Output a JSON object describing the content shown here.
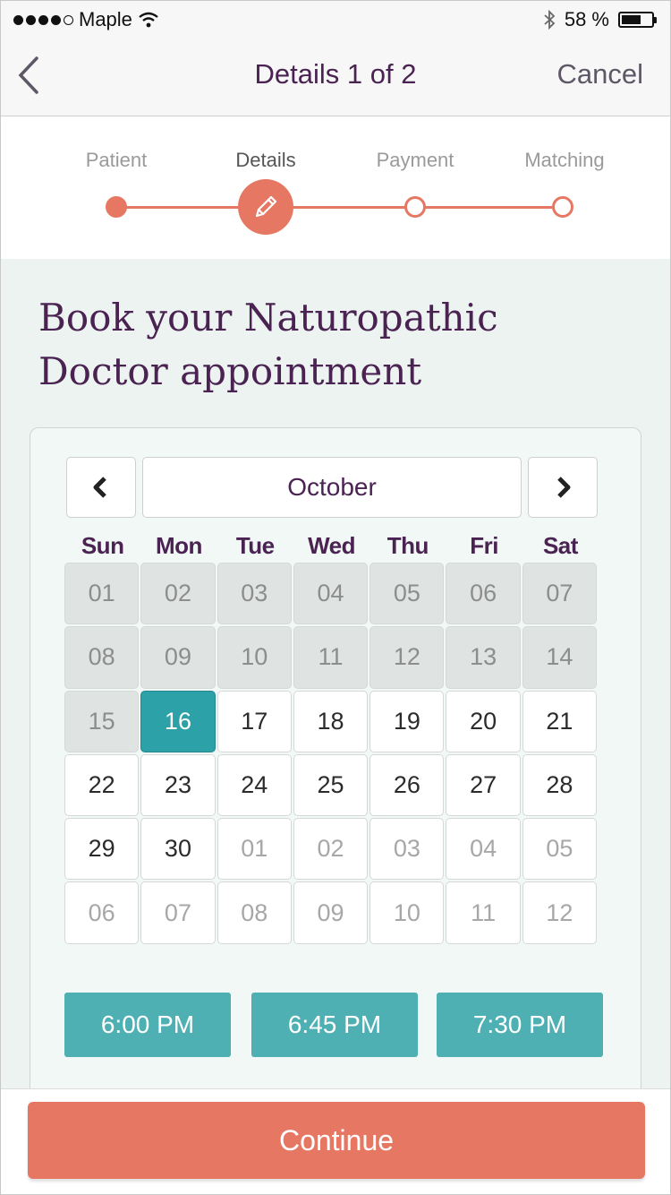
{
  "status_bar": {
    "carrier": "Maple",
    "signal_bars": 4,
    "battery_text": "58 %",
    "battery_level": 0.58
  },
  "nav": {
    "title": "Details 1 of 2",
    "cancel_label": "Cancel",
    "back_icon": "chevron-left-icon"
  },
  "stepper": {
    "steps": [
      {
        "label": "Patient",
        "state": "done"
      },
      {
        "label": "Details",
        "state": "current"
      },
      {
        "label": "Payment",
        "state": "todo"
      },
      {
        "label": "Matching",
        "state": "todo"
      }
    ],
    "accent": "#e67863"
  },
  "heading": "Book your Naturopathic Doctor appointment",
  "calendar": {
    "month": "October",
    "weekdays": [
      "Sun",
      "Mon",
      "Tue",
      "Wed",
      "Thu",
      "Fri",
      "Sat"
    ],
    "days": [
      {
        "label": "01",
        "state": "past"
      },
      {
        "label": "02",
        "state": "past"
      },
      {
        "label": "03",
        "state": "past"
      },
      {
        "label": "04",
        "state": "past"
      },
      {
        "label": "05",
        "state": "past"
      },
      {
        "label": "06",
        "state": "past"
      },
      {
        "label": "07",
        "state": "past"
      },
      {
        "label": "08",
        "state": "past"
      },
      {
        "label": "09",
        "state": "past"
      },
      {
        "label": "10",
        "state": "past"
      },
      {
        "label": "11",
        "state": "past"
      },
      {
        "label": "12",
        "state": "past"
      },
      {
        "label": "13",
        "state": "past"
      },
      {
        "label": "14",
        "state": "past"
      },
      {
        "label": "15",
        "state": "past"
      },
      {
        "label": "16",
        "state": "selected"
      },
      {
        "label": "17",
        "state": "available"
      },
      {
        "label": "18",
        "state": "available"
      },
      {
        "label": "19",
        "state": "available"
      },
      {
        "label": "20",
        "state": "available"
      },
      {
        "label": "21",
        "state": "available"
      },
      {
        "label": "22",
        "state": "available"
      },
      {
        "label": "23",
        "state": "available"
      },
      {
        "label": "24",
        "state": "available"
      },
      {
        "label": "25",
        "state": "available"
      },
      {
        "label": "26",
        "state": "available"
      },
      {
        "label": "27",
        "state": "available"
      },
      {
        "label": "28",
        "state": "available"
      },
      {
        "label": "29",
        "state": "available"
      },
      {
        "label": "30",
        "state": "available"
      },
      {
        "label": "01",
        "state": "other"
      },
      {
        "label": "02",
        "state": "other"
      },
      {
        "label": "03",
        "state": "other"
      },
      {
        "label": "04",
        "state": "other"
      },
      {
        "label": "05",
        "state": "other"
      },
      {
        "label": "06",
        "state": "other"
      },
      {
        "label": "07",
        "state": "other"
      },
      {
        "label": "08",
        "state": "other"
      },
      {
        "label": "09",
        "state": "other"
      },
      {
        "label": "10",
        "state": "other"
      },
      {
        "label": "11",
        "state": "other"
      },
      {
        "label": "12",
        "state": "other"
      }
    ],
    "selected_color": "#2ca1a8"
  },
  "time_slots": [
    "6:00 PM",
    "6:45 PM",
    "7:30 PM"
  ],
  "continue_label": "Continue",
  "colors": {
    "primary_text": "#4a2352",
    "accent": "#e67863",
    "teal": "#4fb0b3",
    "background": "#ecf3f0"
  }
}
